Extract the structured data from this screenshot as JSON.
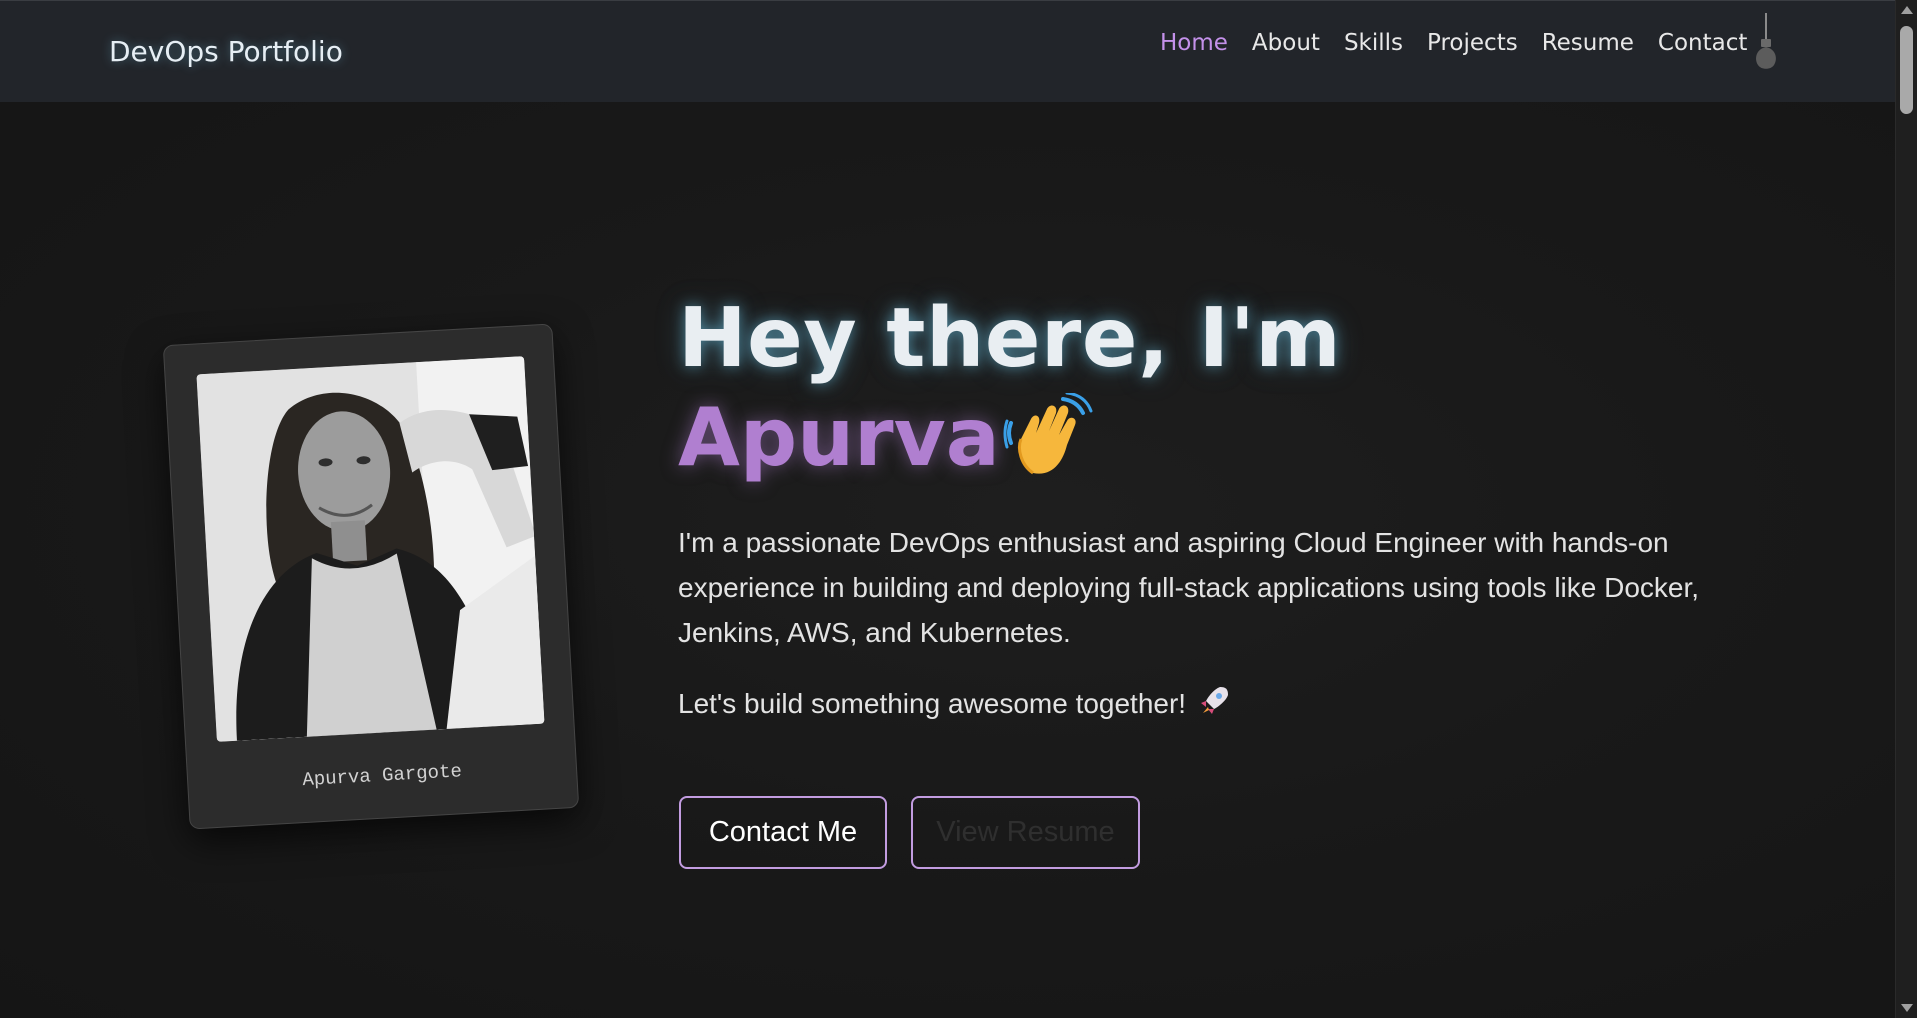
{
  "nav": {
    "brand": "DevOps Portfolio",
    "links": [
      {
        "label": "Home",
        "active": true
      },
      {
        "label": "About"
      },
      {
        "label": "Skills"
      },
      {
        "label": "Projects"
      },
      {
        "label": "Resume"
      },
      {
        "label": "Contact"
      }
    ],
    "theme_toggle_icon": "lightbulb-icon"
  },
  "profile": {
    "caption": "Apurva Gargote",
    "photo_icon": "profile-photo"
  },
  "hero": {
    "greeting": "Hey there, I'm",
    "name": "Apurva",
    "wave_icon": "waving-hand-icon",
    "bio": "I'm a passionate DevOps enthusiast and aspiring Cloud Engineer with hands-on experience in building and deploying full-stack applications using tools like Docker, Jenkins, AWS, and Kubernetes.",
    "tagline": "Let's build something awesome together!",
    "tagline_icon": "rocket-icon"
  },
  "buttons": {
    "contact": "Contact Me",
    "resume": "View Resume"
  },
  "colors": {
    "accent": "#c491ea",
    "name": "#b07fd0",
    "background": "#141414",
    "navbar": "#22252a"
  }
}
